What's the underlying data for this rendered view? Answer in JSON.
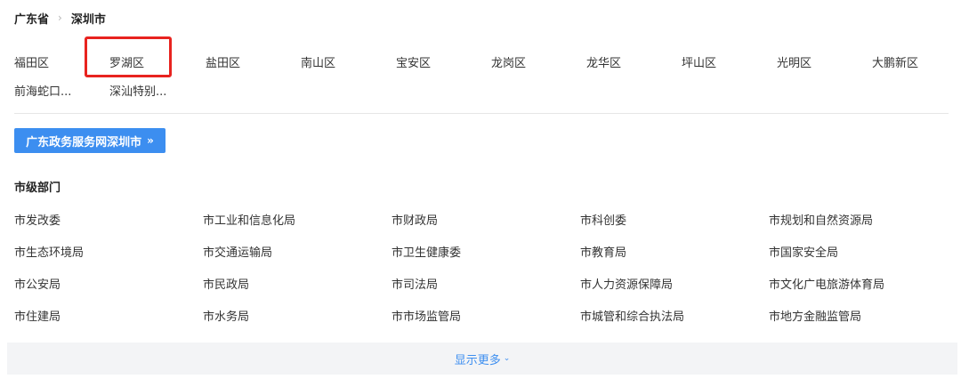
{
  "breadcrumb": {
    "province": "广东省",
    "separator": "›",
    "city": "深圳市"
  },
  "districts": {
    "row1": [
      "福田区",
      "罗湖区",
      "盐田区",
      "南山区",
      "宝安区",
      "龙岗区",
      "龙华区",
      "坪山区",
      "光明区",
      "大鹏新区"
    ],
    "row2": [
      "前海蛇口...",
      "深汕特别..."
    ],
    "selected": "罗湖区",
    "highlight_color": "#e8231f"
  },
  "gov_button": {
    "label": "广东政务服务网深圳市",
    "icon": "double-chevron-right-icon",
    "glyph": "»",
    "color": "#3c8ef0"
  },
  "departments": {
    "title": "市级部门",
    "rows": [
      [
        "市发改委",
        "市工业和信息化局",
        "市财政局",
        "市科创委",
        "市规划和自然资源局"
      ],
      [
        "市生态环境局",
        "市交通运输局",
        "市卫生健康委",
        "市教育局",
        "市国家安全局"
      ],
      [
        "市公安局",
        "市民政局",
        "市司法局",
        "市人力资源保障局",
        "市文化广电旅游体育局"
      ],
      [
        "市住建局",
        "市水务局",
        "市市场监管局",
        "市城管和综合执法局",
        "市地方金融监管局"
      ]
    ]
  },
  "show_more": {
    "label": "显示更多",
    "icon": "chevron-down-icon",
    "glyph": "⌄"
  }
}
